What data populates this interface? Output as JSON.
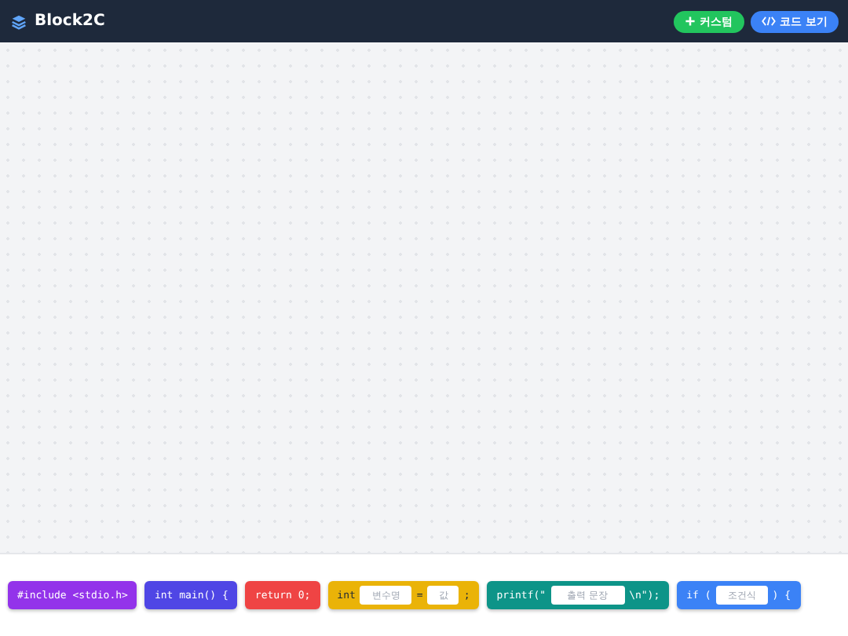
{
  "app": {
    "title": "Block2C"
  },
  "header_buttons": [
    {
      "kind": "add",
      "label": "커스텀",
      "color": "#22c55e"
    },
    {
      "kind": "code",
      "label": "코드 보기",
      "color": "#3b82f6"
    }
  ],
  "palette": [
    {
      "color": "#9333ea",
      "parts": [
        {
          "kind": "code",
          "text": "#include <stdio.h>"
        }
      ]
    },
    {
      "color": "#4f46e5",
      "parts": [
        {
          "kind": "code",
          "text": "int main() {"
        }
      ]
    },
    {
      "color": "#ef4444",
      "parts": [
        {
          "kind": "code",
          "text": "return 0;"
        }
      ]
    },
    {
      "color": "#eab308",
      "parts": [
        {
          "kind": "code",
          "text": "int"
        },
        {
          "kind": "input",
          "placeholder": "변수명"
        },
        {
          "kind": "code",
          "text": "="
        },
        {
          "kind": "input",
          "placeholder": "값"
        },
        {
          "kind": "code",
          "text": ";"
        }
      ]
    },
    {
      "color": "#0d9488",
      "parts": [
        {
          "kind": "code",
          "text": "printf(\""
        },
        {
          "kind": "input",
          "placeholder": "출력 문장"
        },
        {
          "kind": "code",
          "text": "\\n\");"
        }
      ]
    },
    {
      "color": "#3b82f6",
      "parts": [
        {
          "kind": "code",
          "text": "if ("
        },
        {
          "kind": "input",
          "placeholder": "조건식"
        },
        {
          "kind": "code",
          "text": ") {"
        }
      ]
    }
  ]
}
